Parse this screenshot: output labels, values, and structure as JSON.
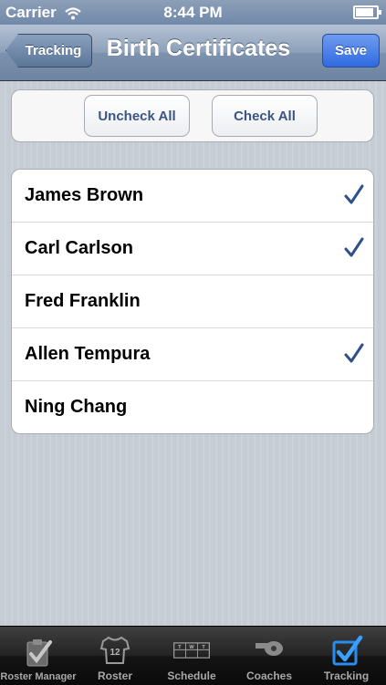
{
  "status": {
    "carrier": "Carrier",
    "time": "8:44 PM"
  },
  "navbar": {
    "back_label": "Tracking",
    "title": "Birth Certificates",
    "save_label": "Save"
  },
  "actions": {
    "uncheck_all": "Uncheck All",
    "check_all": "Check All"
  },
  "people": [
    {
      "name": "James Brown",
      "checked": true
    },
    {
      "name": "Carl Carlson",
      "checked": true
    },
    {
      "name": "Fred Franklin",
      "checked": false
    },
    {
      "name": "Allen Tempura",
      "checked": true
    },
    {
      "name": "Ning Chang",
      "checked": false
    }
  ],
  "tabs": [
    {
      "label": "Roster Manager",
      "icon": "clipboard-check-icon",
      "active": false
    },
    {
      "label": "Roster",
      "icon": "jersey-icon",
      "active": false,
      "icon_text": "12"
    },
    {
      "label": "Schedule",
      "icon": "calendar-icon",
      "active": false,
      "icon_text": [
        "T",
        "W",
        "T"
      ]
    },
    {
      "label": "Coaches",
      "icon": "whistle-icon",
      "active": false
    },
    {
      "label": "Tracking",
      "icon": "checkbox-icon",
      "active": true
    }
  ],
  "colors": {
    "check": "#2e4f8a",
    "active_tab_icon": "#2a8cf0"
  }
}
